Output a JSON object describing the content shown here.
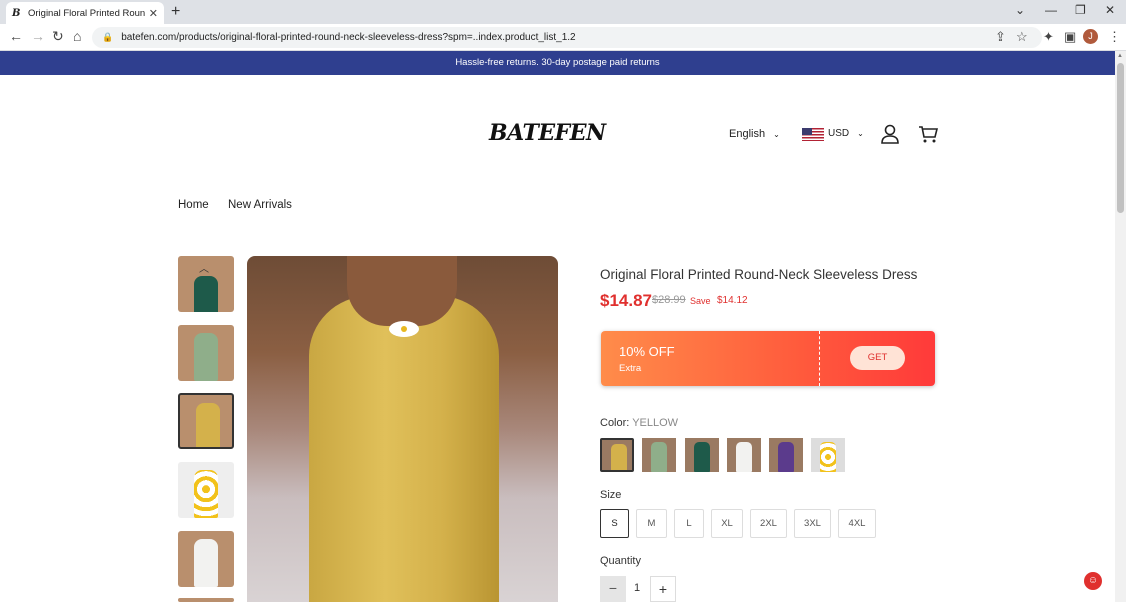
{
  "browser": {
    "tab_title": "Original Floral Printed Round-Ne",
    "tab_favicon": "B",
    "url": "batefen.com/products/original-floral-printed-round-neck-sleeveless-dress?spm=..index.product_list_1.2",
    "avatar_initial": "J"
  },
  "announcement": "Hassle-free returns. 30-day postage paid returns",
  "header": {
    "logo": "BATEFEN",
    "language": "English",
    "currency": "USD"
  },
  "breadcrumb": {
    "home": "Home",
    "category": "New Arrivals"
  },
  "product": {
    "title": "Original Floral Printed Round-Neck Sleeveless Dress",
    "price": "$14.87",
    "old_price": "$28.99",
    "save_label": "Save",
    "save_amount": "$14.12",
    "coupon": {
      "off": "10% OFF",
      "extra": "Extra",
      "button": "GET"
    },
    "color_label": "Color:",
    "color_value": "YELLOW",
    "colors": [
      "yellow",
      "sage",
      "teal",
      "white",
      "purple",
      "sunflower"
    ],
    "size_label": "Size",
    "sizes": [
      "S",
      "M",
      "L",
      "XL",
      "2XL",
      "3XL",
      "4XL"
    ],
    "selected_size": "S",
    "quantity_label": "Quantity",
    "quantity": "1"
  },
  "colors": {
    "announce_bg": "#2f3f8f",
    "price_red": "#e0302e",
    "coupon_orange": "#ff8c4a"
  }
}
